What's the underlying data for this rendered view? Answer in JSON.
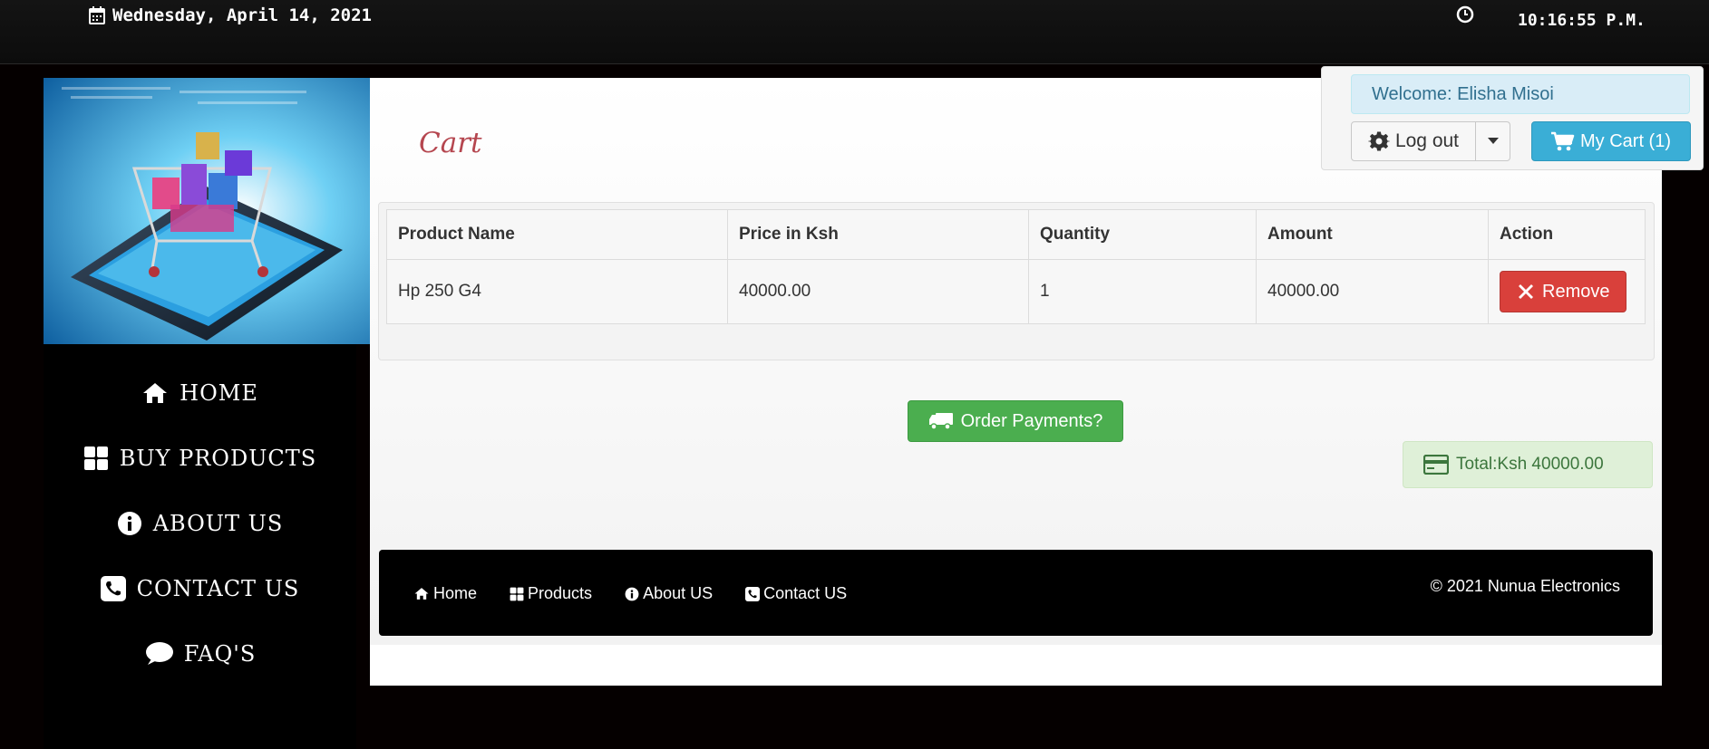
{
  "topbar": {
    "date": "Wednesday, April 14, 2021",
    "time": "10:16:55 P.M."
  },
  "sidebar": {
    "nav": [
      {
        "label": "HOME",
        "icon": "home-icon"
      },
      {
        "label": "BUY PRODUCTS",
        "icon": "grid-icon"
      },
      {
        "label": "ABOUT US",
        "icon": "info-icon"
      },
      {
        "label": "CONTACT US",
        "icon": "phone-icon"
      },
      {
        "label": "FAQ'S",
        "icon": "chat-icon"
      }
    ]
  },
  "main": {
    "title": "Cart",
    "table": {
      "headers": [
        "Product Name",
        "Price in Ksh",
        "Quantity",
        "Amount",
        "Action"
      ],
      "rows": [
        {
          "product": "Hp 250 G4",
          "price": "40000.00",
          "quantity": "1",
          "amount": "40000.00",
          "action": "Remove"
        }
      ]
    },
    "order_button": "Order Payments?",
    "total": "Total:Ksh 40000.00"
  },
  "footer": {
    "links": [
      "Home",
      "Products",
      "About US",
      "Contact US"
    ],
    "copyright": "© 2021 Nunua Electronics"
  },
  "user": {
    "welcome": "Welcome: Elisha Misoi",
    "logout": "Log out",
    "cart": "My Cart (1)"
  },
  "colors": {
    "title": "#b5464f",
    "remove": "#d9403b",
    "order": "#4bae4f",
    "cart_button": "#3aaed6",
    "total_bg": "#dff0d8"
  }
}
